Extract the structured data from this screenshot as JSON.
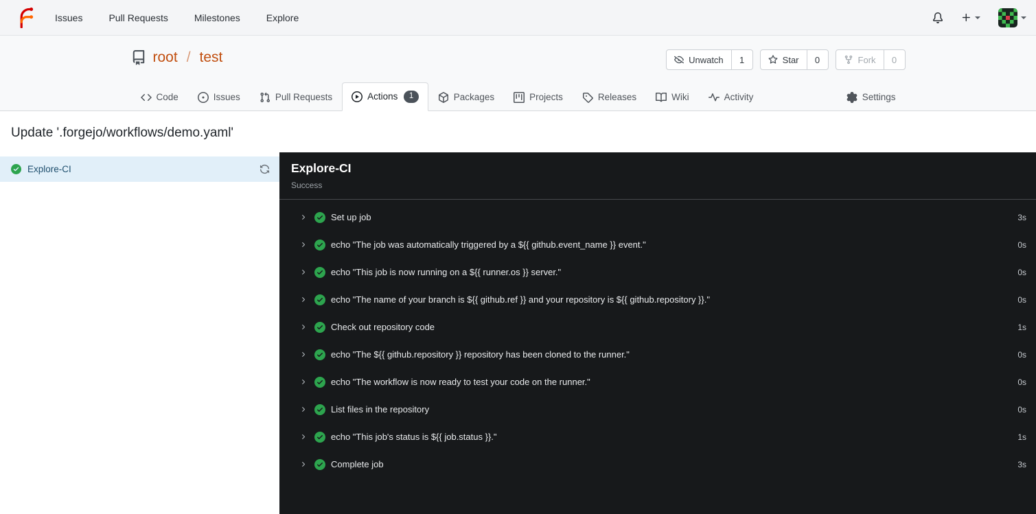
{
  "colors": {
    "accent": "#c14e0e",
    "success": "#2da44e",
    "panel_bg": "#17191b",
    "selected_job_bg": "#e1eff9"
  },
  "topnav": {
    "items": [
      {
        "label": "Issues"
      },
      {
        "label": "Pull Requests"
      },
      {
        "label": "Milestones"
      },
      {
        "label": "Explore"
      }
    ],
    "right_icons": [
      "bell-icon",
      "plus-icon",
      "user-avatar"
    ]
  },
  "repo": {
    "icon": "repo",
    "owner": "root",
    "separator": "/",
    "name": "test",
    "buttons": [
      {
        "label": "Unwatch",
        "icon": "eye-closed",
        "count": "1",
        "disabled": false
      },
      {
        "label": "Star",
        "icon": "star",
        "count": "0",
        "disabled": false
      },
      {
        "label": "Fork",
        "icon": "fork",
        "count": "0",
        "disabled": true
      }
    ],
    "tabs": [
      {
        "label": "Code",
        "icon": "code"
      },
      {
        "label": "Issues",
        "icon": "issue"
      },
      {
        "label": "Pull Requests",
        "icon": "pull-request"
      },
      {
        "label": "Actions",
        "icon": "play-circle",
        "badge": "1",
        "active": true
      },
      {
        "label": "Packages",
        "icon": "package"
      },
      {
        "label": "Projects",
        "icon": "project"
      },
      {
        "label": "Releases",
        "icon": "tag"
      },
      {
        "label": "Wiki",
        "icon": "book"
      },
      {
        "label": "Activity",
        "icon": "pulse"
      },
      {
        "label": "Settings",
        "icon": "gear",
        "align": "right"
      }
    ]
  },
  "run": {
    "title": "Update '.forgejo/workflows/demo.yaml'",
    "jobs": [
      {
        "name": "Explore-CI",
        "status": "success",
        "selected": true
      }
    ],
    "panel": {
      "title": "Explore-CI",
      "status_text": "Success",
      "steps": [
        {
          "name": "Set up job",
          "duration": "3s"
        },
        {
          "name": "echo \"The job was automatically triggered by a ${{ github.event_name }} event.\"",
          "duration": "0s"
        },
        {
          "name": "echo \"This job is now running on a ${{ runner.os }} server.\"",
          "duration": "0s"
        },
        {
          "name": "echo \"The name of your branch is ${{ github.ref }} and your repository is ${{ github.repository }}.\"",
          "duration": "0s"
        },
        {
          "name": "Check out repository code",
          "duration": "1s"
        },
        {
          "name": "echo \"The ${{ github.repository }} repository has been cloned to the runner.\"",
          "duration": "0s"
        },
        {
          "name": "echo \"The workflow is now ready to test your code on the runner.\"",
          "duration": "0s"
        },
        {
          "name": "List files in the repository",
          "duration": "0s"
        },
        {
          "name": "echo \"This job's status is ${{ job.status }}.\"",
          "duration": "1s"
        },
        {
          "name": "Complete job",
          "duration": "3s"
        }
      ]
    }
  }
}
